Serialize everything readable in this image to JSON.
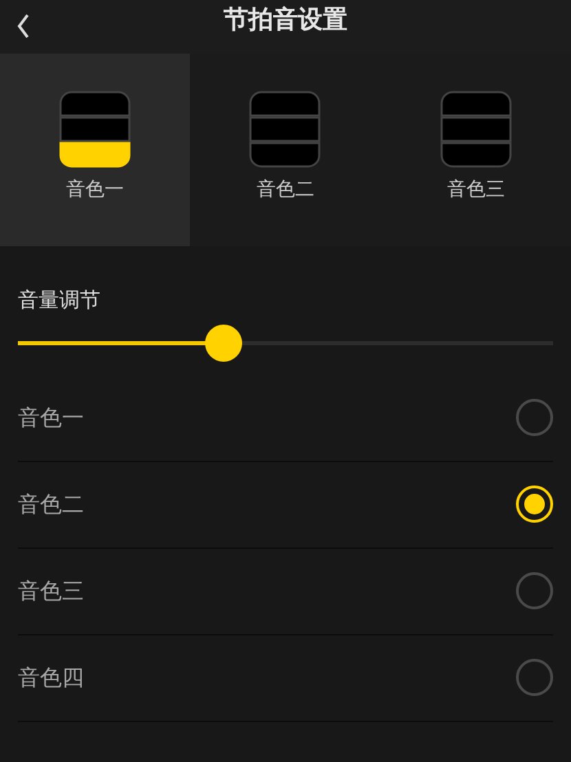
{
  "header": {
    "title": "节拍音设置"
  },
  "tone_tiles": [
    {
      "label": "音色一",
      "selected": true
    },
    {
      "label": "音色二",
      "selected": false
    },
    {
      "label": "音色三",
      "selected": false
    }
  ],
  "volume": {
    "label": "音量调节",
    "level": 0.384
  },
  "tone_options": [
    {
      "label": "音色一",
      "selected": false
    },
    {
      "label": "音色二",
      "selected": true
    },
    {
      "label": "音色三",
      "selected": false
    },
    {
      "label": "音色四",
      "selected": false
    }
  ]
}
